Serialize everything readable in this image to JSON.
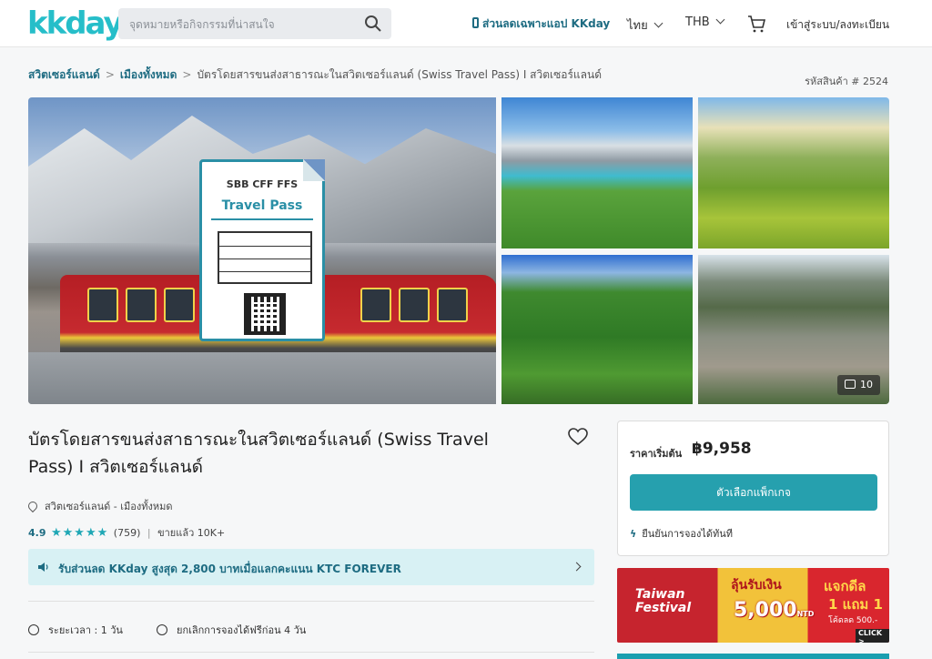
{
  "header": {
    "logo": "kkday",
    "search_placeholder": "จุดหมายหรือกิจกรรมที่น่าสนใจ",
    "app_promo": "ส่วนลดเฉพาะแอป KKday",
    "language": "ไทย",
    "currency": "THB",
    "login": "เข้าสู่ระบบ/ลงทะเบียน"
  },
  "breadcrumb": {
    "items": [
      "สวิตเซอร์แลนด์",
      "เมืองทั้งหมด",
      "บัตรโดยสารขนส่งสาธารณะในสวิตเซอร์แลนด์ (Swiss Travel Pass) I สวิตเซอร์แลนด์"
    ],
    "separator": ">"
  },
  "product_code": "รหัสสินค้า # 2524",
  "gallery": {
    "pass_card_line1": "SBB CFF FFS",
    "pass_card_line2": "Travel Pass",
    "photo_count": "10"
  },
  "product": {
    "title": "บัตรโดยสารขนส่งสาธารณะในสวิตเซอร์แลนด์ (Swiss Travel Pass) I สวิตเซอร์แลนด์",
    "location": "สวิตเซอร์แลนด์ - เมืองทั้งหมด",
    "rating": "4.9",
    "stars": "★★★★★",
    "reviews": "(759)",
    "rating_separator": "|",
    "sold": "ขายแล้ว 10K+",
    "promo": "รับส่วนลด KKday สูงสุด 2,800 บาทเมื่อแลกคะแนน KTC FOREVER",
    "duration": "ระยะเวลา : 1 วัน",
    "cancellation": "ยกเลิกการจองได้ฟรีก่อน 4 วัน"
  },
  "price_box": {
    "from_label": "ราคาเริ่มต้น",
    "price": "฿9,958",
    "button": "ตัวเลือกแพ็กเกจ",
    "instant": "ยืนยันการจองได้ทันที"
  },
  "banner": {
    "festival_line1": "Taiwan",
    "festival_line2": "Festival",
    "cashback_label": "ลุ้นรับเงิน",
    "cashback_amount": "5,000",
    "cashback_unit": "NTD",
    "deal_line1": "แจกดีล",
    "deal_line2": "1 แถม 1",
    "deal_code": "โค้ดลด 500.-",
    "click": "CLICK >"
  },
  "colors": {
    "brand": "#26bec9",
    "link": "#1e6c82",
    "button": "#26a0ae",
    "promo_bg": "#d8f1f4"
  }
}
